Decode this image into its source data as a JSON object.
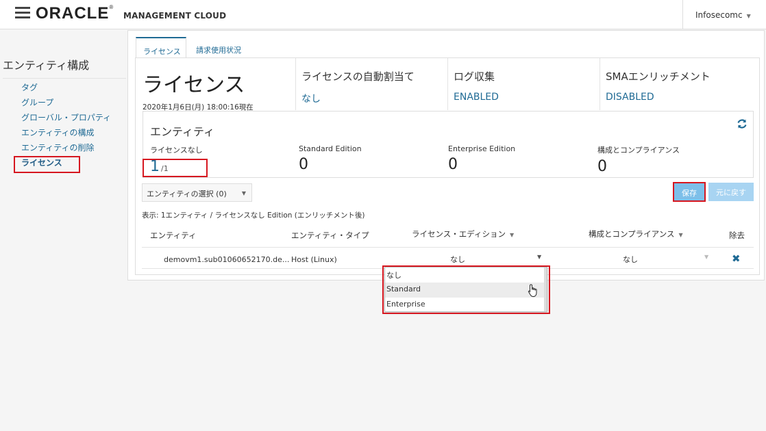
{
  "header": {
    "brand": "ORACLE",
    "product": "MANAGEMENT CLOUD",
    "user": "Infosecomc"
  },
  "sidebar": {
    "title": "エンティティ構成",
    "items": [
      {
        "label": "タグ"
      },
      {
        "label": "グループ"
      },
      {
        "label": "グローバル・プロパティ"
      },
      {
        "label": "エンティティの構成"
      },
      {
        "label": "エンティティの削除"
      },
      {
        "label": "ライセンス"
      }
    ]
  },
  "tabs": [
    {
      "label": "ライセンス"
    },
    {
      "label": "請求使用状況"
    }
  ],
  "license": {
    "title": "ライセンス",
    "timestamp": "2020年1月6日(月) 18:00:16現在",
    "auto_assign_label": "ライセンスの自動割当て",
    "auto_assign_value": "なし",
    "log_label": "ログ収集",
    "log_value": "ENABLED",
    "sma_label": "SMAエンリッチメント",
    "sma_value": "DISABLED"
  },
  "entity_summary": {
    "title": "エンティティ",
    "unlicensed_label": "ライセンスなし",
    "unlicensed_value": "1",
    "unlicensed_total": "/1",
    "standard_label": "Standard Edition",
    "standard_value": "0",
    "enterprise_label": "Enterprise Edition",
    "enterprise_value": "0",
    "compliance_label": "構成とコンプライアンス",
    "compliance_value": "0"
  },
  "toolbar": {
    "select_label": "エンティティの選択 (0)",
    "save_label": "保存",
    "revert_label": "元に戻す"
  },
  "table": {
    "summary": "表示: 1エンティティ / ライセンスなし Edition (エンリッチメント後)",
    "headers": [
      "エンティティ",
      "エンティティ・タイプ",
      "ライセンス・エディション",
      "構成とコンプライアンス",
      "除去"
    ],
    "rows": [
      {
        "entity": "demovm1.sub01060652170.de...",
        "type": "Host (Linux)",
        "edition": "なし",
        "compliance": "なし"
      }
    ]
  },
  "dropdown": {
    "options": [
      "なし",
      "Standard",
      "Enterprise"
    ]
  },
  "colors": {
    "accent": "#1f6a94",
    "highlight": "#d6161f",
    "save_button": "#7dbfe9"
  }
}
